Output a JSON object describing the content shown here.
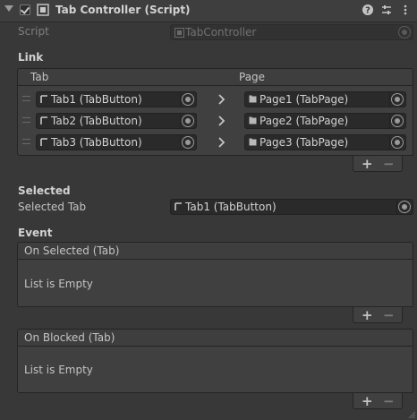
{
  "component": {
    "title": "Tab Controller (Script)"
  },
  "script_field": {
    "label": "Script",
    "value": "TabController"
  },
  "link": {
    "section_label": "Link",
    "col_tab": "Tab",
    "col_page": "Page",
    "rows": [
      {
        "tab": "Tab1 (TabButton)",
        "page": "Page1 (TabPage)"
      },
      {
        "tab": "Tab2 (TabButton)",
        "page": "Page2 (TabPage)"
      },
      {
        "tab": "Tab3 (TabButton)",
        "page": "Page3 (TabPage)"
      }
    ],
    "add_label": "+",
    "remove_label": "−"
  },
  "selected": {
    "section_label": "Selected",
    "field_label": "Selected Tab",
    "value": "Tab1 (TabButton)"
  },
  "event": {
    "section_label": "Event",
    "lists": [
      {
        "header": "On Selected (Tab)",
        "empty_text": "List is Empty"
      },
      {
        "header": "On Blocked (Tab)",
        "empty_text": "List is Empty"
      }
    ],
    "add_label": "+",
    "remove_label": "−"
  },
  "icons": {
    "help": "?",
    "presets": "⇅",
    "menu": "⋮"
  }
}
